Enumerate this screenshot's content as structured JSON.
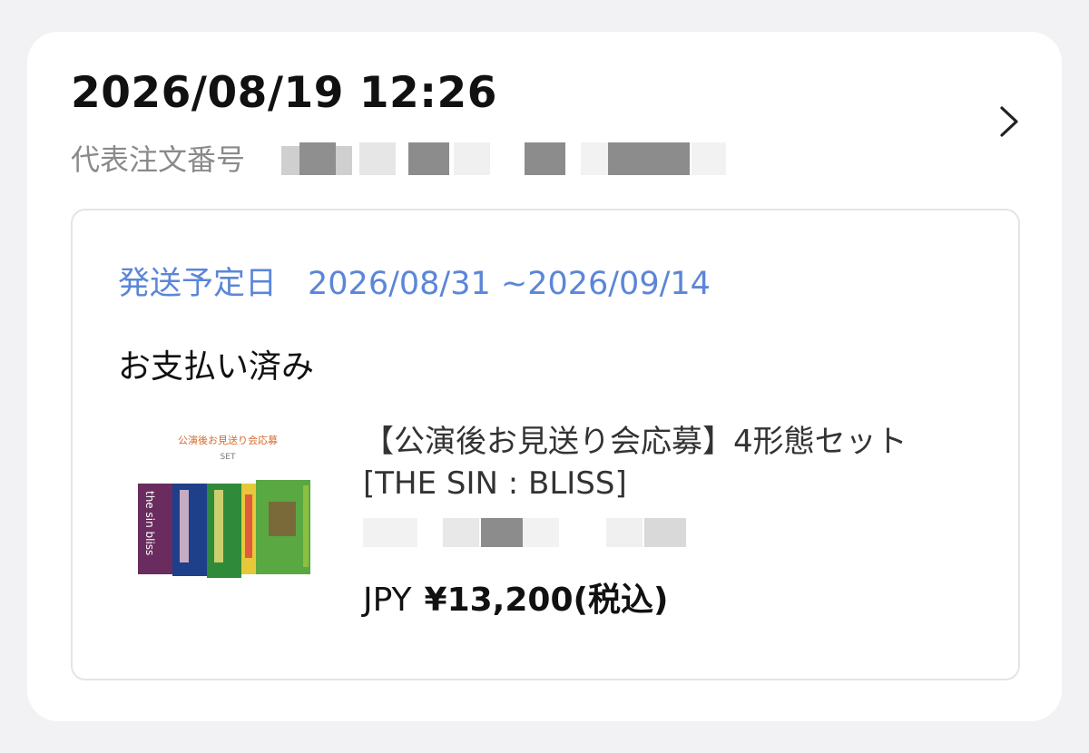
{
  "order": {
    "datetime": "2026/08/19 12:26",
    "number_label": "代表注文番号"
  },
  "icons": {
    "chevron": "chevron-right-icon"
  },
  "shipping": {
    "label": "発送予定日",
    "range": "2026/08/31 ~2026/09/14",
    "color": "#5b86d9"
  },
  "payment": {
    "status": "お支払い済み"
  },
  "product": {
    "name": "【公演後お見送り会応募】4形態セット[THE SIN : BLISS]",
    "thumbnail": {
      "heading": "公演後お見送り会応募",
      "subheading": "SET",
      "spine_text": "the sin bliss"
    },
    "currency": "JPY",
    "price": "¥13,200(税込)"
  }
}
